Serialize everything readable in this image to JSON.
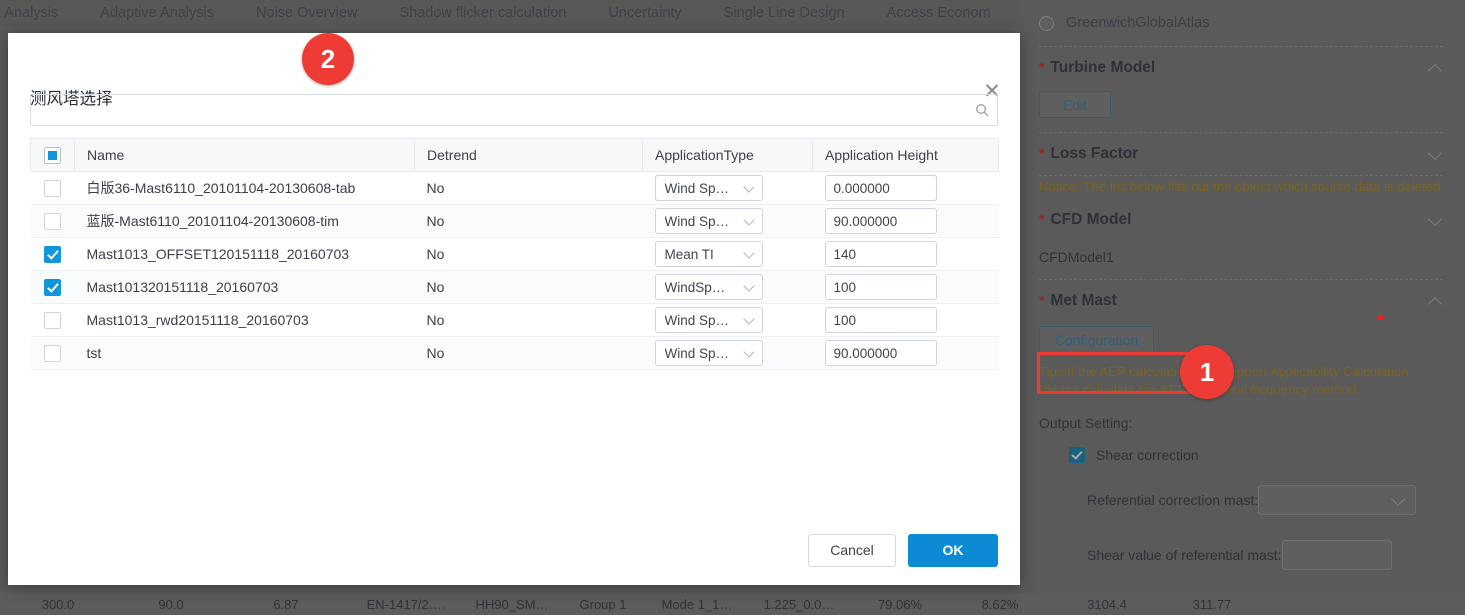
{
  "topnav": {
    "tabs": [
      {
        "label": "d Analysis"
      },
      {
        "label": "Adaptive Analysis"
      },
      {
        "label": "Noise Overview"
      },
      {
        "label": "Shadow flicker calculation"
      },
      {
        "label": "Uncertainty"
      },
      {
        "label": "Single Line Design"
      },
      {
        "label": "Access Econom"
      }
    ]
  },
  "modal": {
    "title": "测风塔选择",
    "close_label": "✕",
    "search": {
      "value": "",
      "placeholder": "",
      "icon": "search-icon"
    },
    "table": {
      "columns": [
        "",
        "Name",
        "Detrend",
        "ApplicationType",
        "Application Height"
      ],
      "header_checkbox_state": "indeterminate",
      "rows": [
        {
          "checked": false,
          "name": "白版36-Mast6110_20101104-20130608-tab",
          "detrend": "No",
          "application_type": "Wind Sp…",
          "application_height": "0.000000"
        },
        {
          "checked": false,
          "name": "蓝版-Mast6110_20101104-20130608-tim",
          "detrend": "No",
          "application_type": "Wind Sp…",
          "application_height": "90.000000"
        },
        {
          "checked": true,
          "name": "Mast1013_OFFSET120151118_20160703",
          "detrend": "No",
          "application_type": "Mean TI",
          "application_height": "140"
        },
        {
          "checked": true,
          "name": "Mast101320151118_20160703",
          "detrend": "No",
          "application_type": "WindSp…",
          "application_height": "100"
        },
        {
          "checked": false,
          "name": "Mast1013_rwd20151118_20160703",
          "detrend": "No",
          "application_type": "Wind Sp…",
          "application_height": "100"
        },
        {
          "checked": false,
          "name": "tst",
          "detrend": "No",
          "application_type": "Wind Sp…",
          "application_height": "90.000000"
        }
      ]
    },
    "footer": {
      "cancel_label": "Cancel",
      "ok_label": "OK"
    }
  },
  "right_panel": {
    "atlas_option": "GreenwichGlobalAtlas",
    "turbine_model": {
      "title": "Turbine Model",
      "required_mark": "*",
      "edit_label": "Edit",
      "expanded": true
    },
    "loss_factor": {
      "title": "Loss Factor",
      "required_mark": "*",
      "expanded": false
    },
    "notice": "Notice: The list below filts out the object which source data is deleted",
    "cfd_model": {
      "title": "CFD Model",
      "required_mark": "*",
      "expanded": false,
      "value": "CFDModel1"
    },
    "met_mast": {
      "title": "Met Mast",
      "required_mark": "*",
      "expanded": true,
      "configuration_label": "Configuration",
      "tip": "Tips:If the AEP calculation is to support Applicability Calculation. Please calculate the AEP using real frequency method.",
      "output_setting_label": "Output Setting:",
      "shear_correction_label": "Shear correction",
      "shear_correction_checked": true,
      "referential_correction_mast_label": "Referential correction mast:",
      "referential_correction_mast_value": "",
      "shear_value_label": "Shear value of referential mast:",
      "shear_value": ""
    }
  },
  "bottom_strip": {
    "cells": [
      "300.0",
      "90.0",
      "6.87",
      "EN-1417/2….",
      "HH90_SM…",
      "Group 1",
      "Mode 1_1…",
      "1.225_0.0…",
      "79.06%",
      "8.62%",
      "3104.4",
      "311.77"
    ]
  },
  "annotations": {
    "badge_1": "1",
    "badge_2": "2"
  },
  "colors": {
    "accent_blue": "#1296db",
    "primary_button": "#0c8bd4",
    "annotation_red": "#ef3b36",
    "notice_yellow": "#b8860b"
  }
}
